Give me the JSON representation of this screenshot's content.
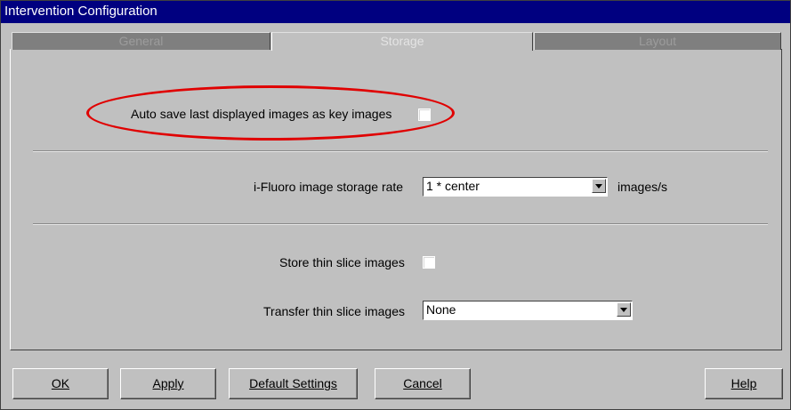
{
  "window": {
    "title": "Intervention Configuration"
  },
  "tabs": [
    {
      "label": "General",
      "active": false
    },
    {
      "label": "Storage",
      "active": true
    },
    {
      "label": "Layout",
      "active": false
    }
  ],
  "storage": {
    "auto_save_label": "Auto save last displayed images as key images",
    "auto_save_checked": false,
    "ifluoro_label": "i-Fluoro image storage rate",
    "ifluoro_value": "1 * center",
    "ifluoro_unit": "images/s",
    "store_thin_label": "Store thin slice images",
    "store_thin_checked": false,
    "transfer_thin_label": "Transfer thin slice images",
    "transfer_thin_value": "None"
  },
  "buttons": {
    "ok_label": "OK",
    "apply_label": "Apply",
    "default_label": "Default Settings",
    "cancel_label": "Cancel",
    "help_label": "Help"
  },
  "annotation": {
    "color": "#e00000"
  }
}
